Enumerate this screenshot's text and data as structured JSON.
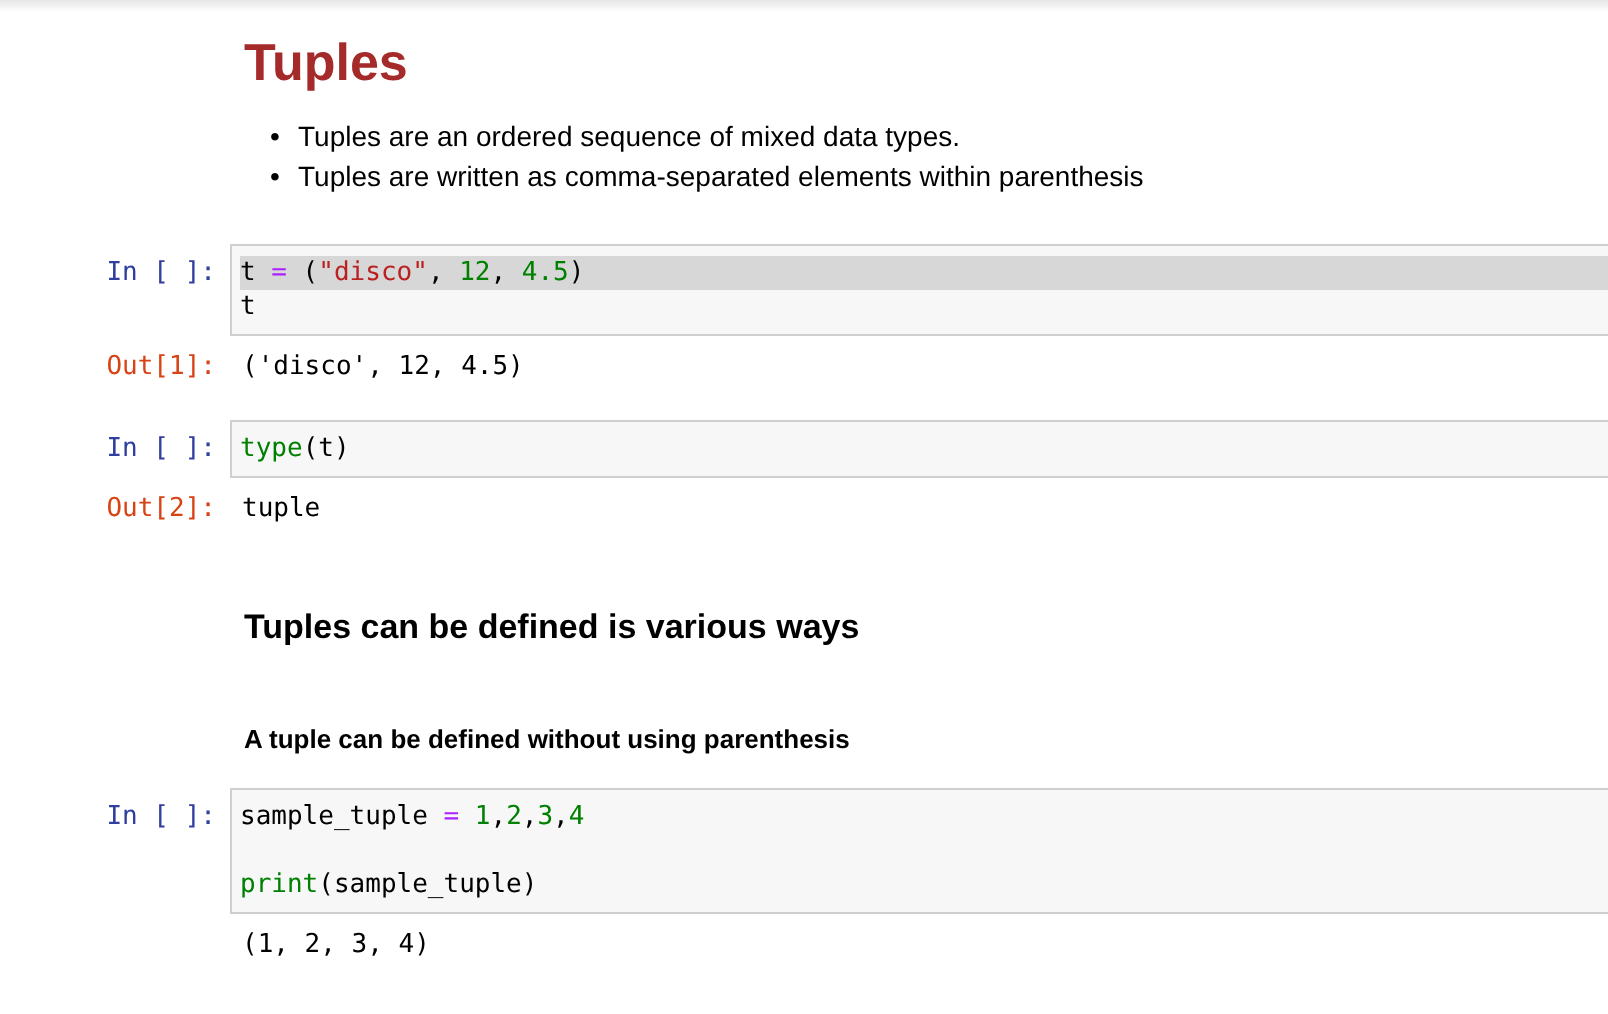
{
  "title": "Tuples",
  "bullets": [
    {
      "marker": "•",
      "text": "Tuples are an ordered sequence of mixed data types."
    },
    {
      "marker": "•",
      "text": "Tuples are written as comma-separated elements within parenthesis"
    }
  ],
  "cells": [
    {
      "kind": "code",
      "prompt": "In [ ]:",
      "lines": [
        {
          "highlighted": true,
          "gap_before": false,
          "tokens": [
            {
              "kind": "name",
              "text": "t "
            },
            {
              "kind": "op",
              "text": "="
            },
            {
              "kind": "name",
              "text": " ("
            },
            {
              "kind": "string",
              "text": "\"disco\""
            },
            {
              "kind": "name",
              "text": ", "
            },
            {
              "kind": "number",
              "text": "12"
            },
            {
              "kind": "name",
              "text": ", "
            },
            {
              "kind": "number",
              "text": "4.5"
            },
            {
              "kind": "name",
              "text": ")"
            }
          ]
        },
        {
          "highlighted": false,
          "gap_before": false,
          "tokens": [
            {
              "kind": "name",
              "text": "t"
            }
          ]
        }
      ]
    },
    {
      "kind": "output",
      "prompt": "Out[1]:",
      "text": "('disco', 12, 4.5)"
    },
    {
      "kind": "code",
      "prompt": "In [ ]:",
      "lines": [
        {
          "highlighted": false,
          "gap_before": false,
          "tokens": [
            {
              "kind": "builtin",
              "text": "type"
            },
            {
              "kind": "name",
              "text": "(t)"
            }
          ]
        }
      ]
    },
    {
      "kind": "output",
      "prompt": "Out[2]:",
      "text": "tuple"
    },
    {
      "kind": "heading",
      "text": "Tuples can be defined is various ways"
    },
    {
      "kind": "subheading",
      "text": "A tuple can be defined without using parenthesis"
    },
    {
      "kind": "code",
      "prompt": "In [ ]:",
      "lines": [
        {
          "highlighted": false,
          "gap_before": false,
          "tokens": [
            {
              "kind": "name",
              "text": "sample_tuple "
            },
            {
              "kind": "op",
              "text": "= "
            },
            {
              "kind": "number",
              "text": "1"
            },
            {
              "kind": "name",
              "text": ","
            },
            {
              "kind": "number",
              "text": "2"
            },
            {
              "kind": "name",
              "text": ","
            },
            {
              "kind": "number",
              "text": "3"
            },
            {
              "kind": "name",
              "text": ","
            },
            {
              "kind": "number",
              "text": "4"
            }
          ]
        },
        {
          "highlighted": false,
          "gap_before": true,
          "tokens": [
            {
              "kind": "builtin",
              "text": "print"
            },
            {
              "kind": "name",
              "text": "(sample_tuple)"
            }
          ]
        }
      ]
    },
    {
      "kind": "stream",
      "text": "(1, 2, 3, 4)"
    }
  ]
}
